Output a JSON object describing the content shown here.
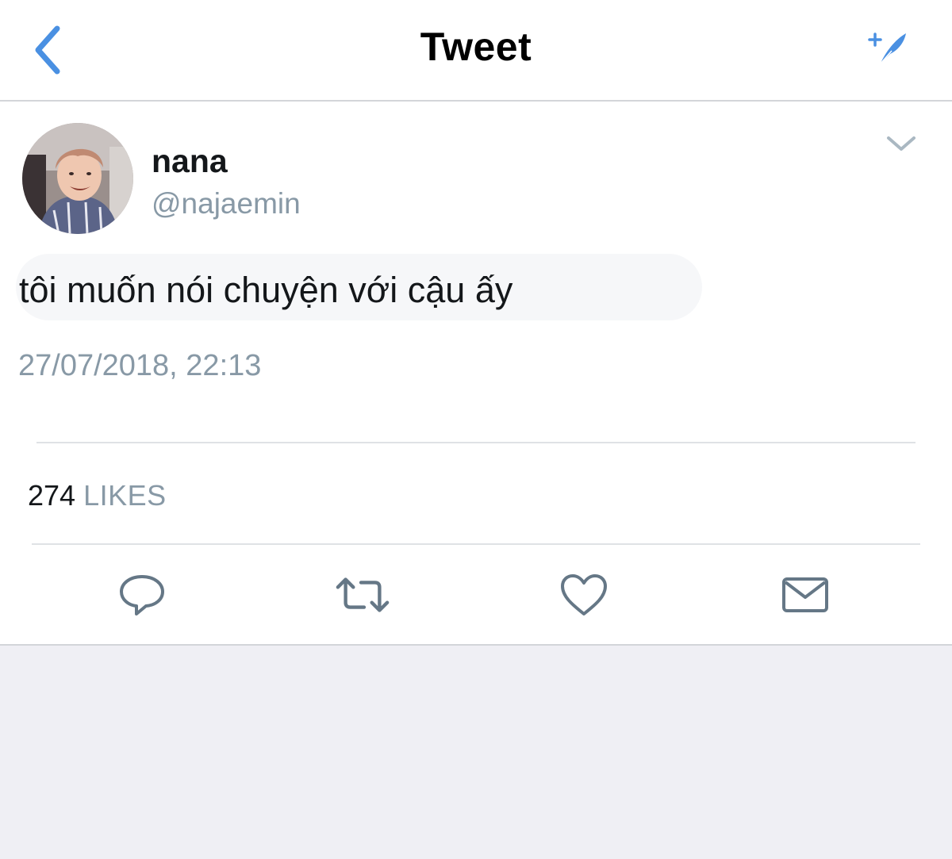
{
  "header": {
    "title": "Tweet",
    "back_icon": "chevron-left-icon",
    "compose_icon": "compose-tweet-icon",
    "accent_color": "#4a90e2"
  },
  "tweet": {
    "author": {
      "display_name": "nana",
      "handle": "@najaemin"
    },
    "text": "tôi muốn nói chuyện với cậu ấy",
    "timestamp": "27/07/2018, 22:13",
    "stats": {
      "likes_count": "274",
      "likes_label": "LIKES"
    },
    "actions": [
      "reply-icon",
      "retweet-icon",
      "like-icon",
      "direct-message-icon"
    ]
  },
  "colors": {
    "text": "#14171a",
    "secondary": "#8899a6",
    "action_icon": "#657786",
    "background": "#efeff4"
  }
}
